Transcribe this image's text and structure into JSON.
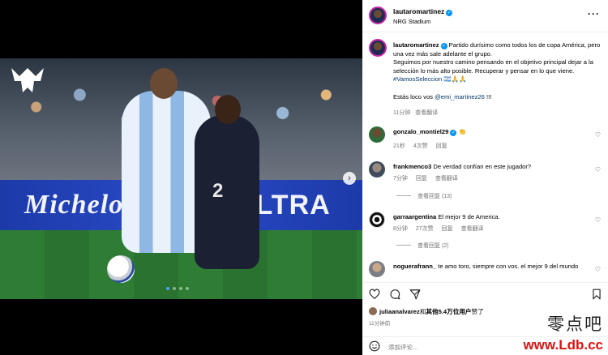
{
  "colors": {
    "verified": "#0095f6",
    "link": "#00376b",
    "meta_gray": "#737373",
    "watermark_red": "#dd1111"
  },
  "media": {
    "boards": {
      "left_text": "Michelob",
      "right_text": "ULTRA"
    },
    "jersey_number": "2",
    "logo_icon": "horned-m-logo-icon",
    "next_icon": "chevron-right-icon",
    "carousel_count": 4,
    "carousel_active": 1
  },
  "header": {
    "username": "lautaromartinez",
    "location": "NRG Stadium",
    "more_icon": "more-horizontal-icon"
  },
  "caption": {
    "username": "lautaromartinez",
    "line1": "Partido durísimo como todos los de copa América, pero una vez más sale adelante el grupo.",
    "line2": "Seguimos por nuestro camino pensando en el objetivo principal dejar a la selección lo más alto posible. Recuperar y pensar en lo que viene.",
    "hashtag": "#VamosSeleccion",
    "emojis": "🇦🇷🙏🙏",
    "line3_prefix": "Estás loco vos",
    "mention": "@emi_martinez26",
    "line3_suffix": "!!!",
    "time": "11分钟",
    "translate": "查看翻译"
  },
  "comments": [
    {
      "username": "gonzalo_montiel29",
      "text": "👏",
      "verified": true,
      "time": "21秒",
      "likes": "4次赞",
      "reply": "回复",
      "translate": "",
      "replies": ""
    },
    {
      "username": "frankmenco3",
      "text": "De verdad confían en este jugador?",
      "verified": false,
      "time": "7分钟",
      "likes": "",
      "reply": "回复",
      "translate": "查看翻译",
      "replies": "查看回复 (13)"
    },
    {
      "username": "garraargentina",
      "text": "El mejor 9 de America.",
      "verified": false,
      "time": "8分钟",
      "likes": "27次赞",
      "reply": "回复",
      "translate": "查看翻译",
      "replies": "查看回复 (2)"
    },
    {
      "username": "noguerafrann_",
      "text": "te amo toro, siempre con vos. el mejor 9 del mundo",
      "verified": false,
      "time": "",
      "likes": "",
      "reply": "",
      "translate": "",
      "replies": ""
    }
  ],
  "actions": {
    "like_icon": "heart-icon",
    "comment_icon": "comment-icon",
    "share_icon": "send-icon",
    "save_icon": "bookmark-icon"
  },
  "likes": {
    "user": "juliaanalvarez",
    "middle": "和",
    "others": "其他5.4万位用户",
    "suffix": "赞了"
  },
  "post_time": "11分钟前",
  "add_comment": {
    "placeholder": "添加评论...",
    "emoji_icon": "smiley-icon"
  },
  "watermark": {
    "cn": "零点吧",
    "url": "www.Ldb.cc"
  }
}
